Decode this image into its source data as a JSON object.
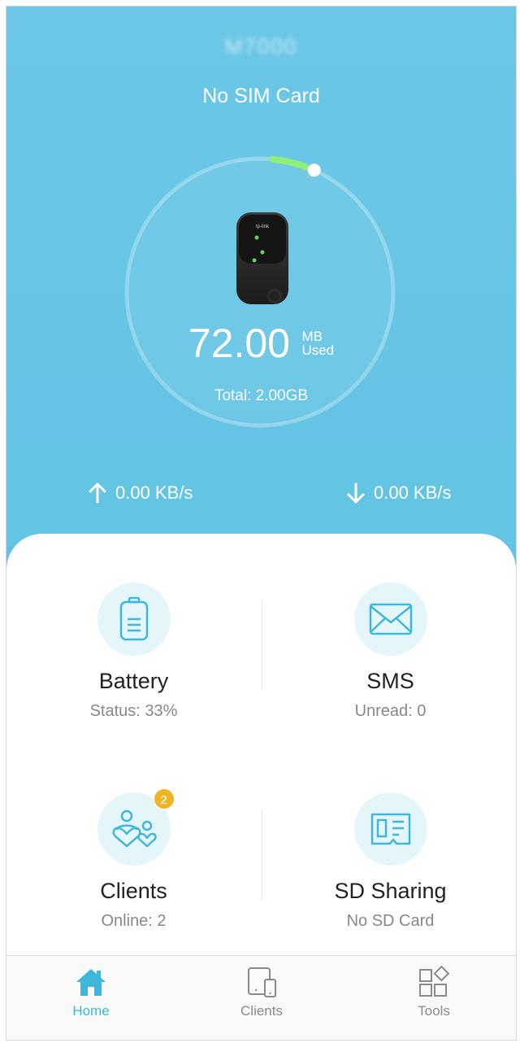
{
  "header": {
    "device_name": "M7000",
    "sim_status": "No SIM Card"
  },
  "usage": {
    "used_value": "72.00",
    "used_unit_top": "MB",
    "used_unit_bottom": "Used",
    "total": "Total: 2.00GB",
    "used_fraction": 0.035
  },
  "speed": {
    "upload": "0.00 KB/s",
    "download": "0.00 KB/s"
  },
  "tiles": [
    {
      "title": "Battery",
      "subtitle": "Status: 33%",
      "icon": "battery-icon"
    },
    {
      "title": "SMS",
      "subtitle": "Unread: 0",
      "icon": "envelope-icon"
    },
    {
      "title": "Clients",
      "subtitle": "Online: 2",
      "icon": "clients-icon",
      "badge": "2"
    },
    {
      "title": "SD Sharing",
      "subtitle": "No SD Card",
      "icon": "sd-card-icon"
    }
  ],
  "nav": [
    {
      "label": "Home",
      "icon": "home-icon",
      "active": true
    },
    {
      "label": "Clients",
      "icon": "devices-icon",
      "active": false
    },
    {
      "label": "Tools",
      "icon": "tools-grid-icon",
      "active": false
    }
  ],
  "colors": {
    "hero_blue": "#66c5e5",
    "accent": "#3fb6db",
    "ring_progress": "#8ef07a",
    "badge": "#f0b429",
    "icon_circle": "#e5f6fb"
  }
}
